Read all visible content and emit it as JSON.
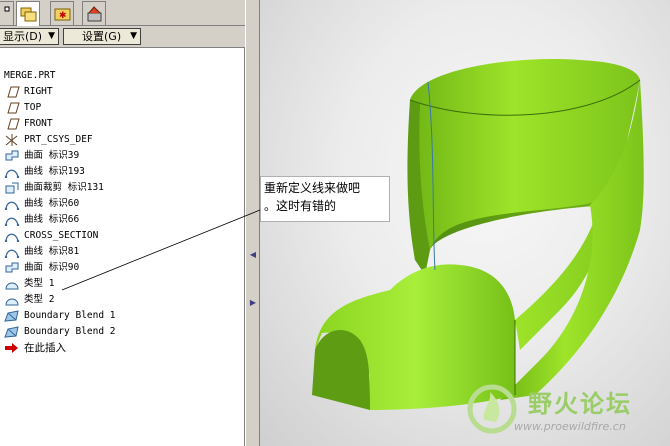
{
  "toolbar": {
    "show_label": "显示(D)",
    "settings_label": "设置(G)"
  },
  "tree": {
    "root": "MERGE.PRT",
    "items": [
      {
        "label": "RIGHT",
        "icon": "datum-plane-icon"
      },
      {
        "label": "TOP",
        "icon": "datum-plane-icon"
      },
      {
        "label": "FRONT",
        "icon": "datum-plane-icon"
      },
      {
        "label": "PRT_CSYS_DEF",
        "icon": "coordinate-system-icon"
      },
      {
        "label": "曲面 标识39",
        "icon": "surface-icon"
      },
      {
        "label": "曲线 标识193",
        "icon": "curve-icon"
      },
      {
        "label": "曲面裁剪 标识131",
        "icon": "surface-trim-icon"
      },
      {
        "label": "曲线 标识60",
        "icon": "curve-icon"
      },
      {
        "label": "曲线 标识66",
        "icon": "curve-icon"
      },
      {
        "label": "CROSS_SECTION",
        "icon": "curve-icon"
      },
      {
        "label": "曲线 标识81",
        "icon": "curve-icon"
      },
      {
        "label": "曲面 标识90",
        "icon": "surface-icon"
      },
      {
        "label": "类型 1",
        "icon": "type-feature-icon"
      },
      {
        "label": "类型 2",
        "icon": "type-feature-icon"
      },
      {
        "label": "Boundary Blend 1",
        "icon": "boundary-blend-icon"
      },
      {
        "label": "Boundary Blend 2",
        "icon": "boundary-blend-icon"
      },
      {
        "label": "在此插入",
        "icon": "insert-here-arrow-icon"
      }
    ]
  },
  "callout": {
    "line1": "重新定义线来做吧",
    "line2": "。这时有错的"
  },
  "watermark": {
    "title": "野火论坛",
    "url": "www.proewildfire.cn"
  },
  "colors": {
    "surface_green": "#8fd81c",
    "surface_dark": "#4f8a10",
    "insert_arrow": "#cc0000",
    "tree_icon": "#336699"
  }
}
